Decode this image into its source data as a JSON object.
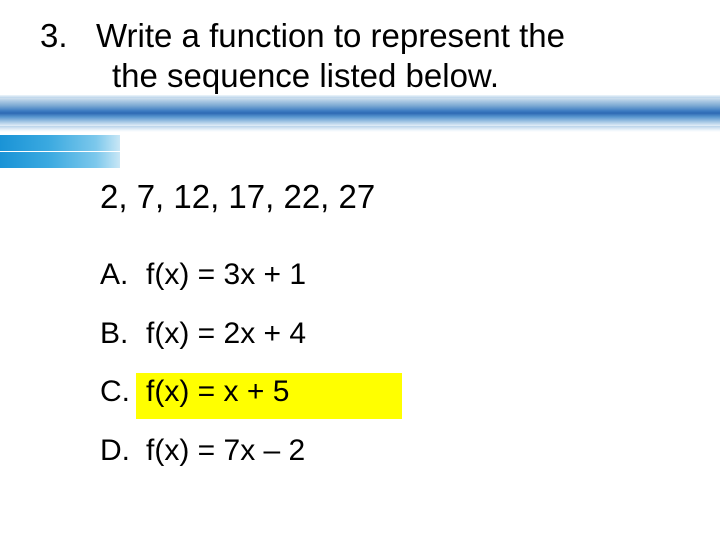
{
  "question": {
    "number": "3.",
    "line1": "Write a function to represent the",
    "line2": "the sequence listed below."
  },
  "sequence": "2, 7, 12, 17, 22, 27",
  "choices": {
    "a": {
      "letter": "A.",
      "text": "f(x) = 3x + 1"
    },
    "b": {
      "letter": "B.",
      "text": "f(x) = 2x + 4"
    },
    "c": {
      "letter": "C.",
      "text": "f(x) = x + 5"
    },
    "d": {
      "letter": "D.",
      "text": "f(x) = 7x – 2"
    }
  },
  "highlighted_choice": "c"
}
